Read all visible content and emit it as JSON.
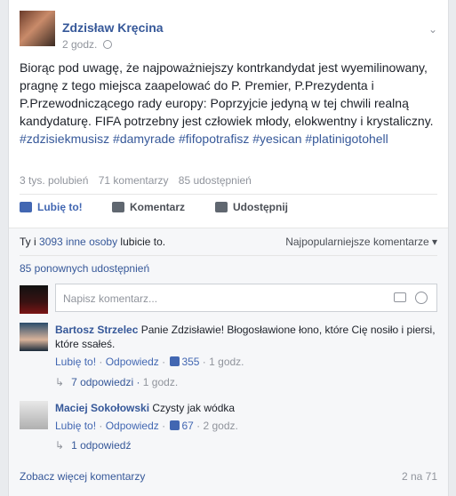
{
  "post": {
    "author": "Zdzisław Kręcina",
    "time": "2 godz.",
    "text": "Biorąc pod uwagę, że najpoważniejszy kontrkandydat jest wyemilinowany, pragnę z tego miejsca zaapelować do P. Premier, P.Prezydenta i P.Przewodniczącego rady europy: Poprzyjcie jedyną w tej chwili realną kandydaturę. FIFA potrzebny jest człowiek młody, elokwentny i krystaliczny.",
    "hashtags": "#zdzisiekmusisz #damyrade #fifopotrafisz #yesican #platinigotohell"
  },
  "stats": {
    "likes": "3 tys. polubień",
    "comments": "71 komentarzy",
    "shares": "85 udostępnień"
  },
  "actions": {
    "like": "Lubię to!",
    "comment": "Komentarz",
    "share": "Udostępnij"
  },
  "likes_row": {
    "you": "Ty",
    "and": " i ",
    "others": "3093 inne osoby",
    "tail": " lubicie to."
  },
  "sort_label": "Najpopularniejsze komentarze ▾",
  "reshares": "85 ponownych udostępnień",
  "composer": {
    "placeholder": "Napisz komentarz..."
  },
  "comments": [
    {
      "author": "Bartosz Strzelec",
      "text": " Panie Zdzisławie! Błogosławione łono, które Cię nosiło i piersi, które ssałeś.",
      "like": "Lubię to!",
      "reply": "Odpowiedz",
      "likes": "355",
      "time": "1 godz.",
      "replies": "7 odpowiedzi",
      "replies_time": "1 godz."
    },
    {
      "author": "Maciej Sokołowski",
      "text": " Czysty jak wódka",
      "like": "Lubię to!",
      "reply": "Odpowiedz",
      "likes": "67",
      "time": "2 godz.",
      "replies": "1 odpowiedź",
      "replies_time": ""
    }
  ],
  "footer": {
    "more": "Zobacz więcej komentarzy",
    "count": "2 na 71"
  }
}
